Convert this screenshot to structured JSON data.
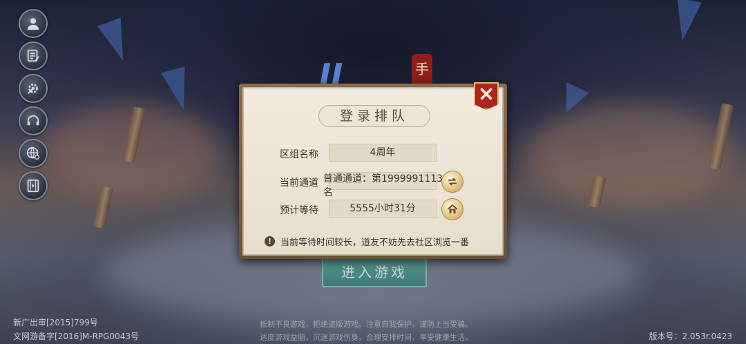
{
  "background": {
    "logo_text": "JJ",
    "logo_seal": "手",
    "enter_button": "进入游戏"
  },
  "side_menu": [
    {
      "icon": "user-icon"
    },
    {
      "icon": "notice-scroll-icon"
    },
    {
      "icon": "settings-icon"
    },
    {
      "icon": "headset-icon"
    },
    {
      "icon": "globe-search-icon"
    },
    {
      "icon": "video-icon"
    }
  ],
  "dialog": {
    "title": "登录排队",
    "close_icon": "close-icon",
    "zone_label": "区组名称",
    "zone_value": "4周年",
    "channel_label": "当前通道",
    "channel_value": "普通通道：第1999991113名",
    "wait_label": "预计等待",
    "wait_value": "5555小时31分",
    "notice_icon": "!",
    "notice": "当前等待时间较长，道友不妨先去社区浏览一番"
  },
  "footer": {
    "license_1": "新广出审[2015]799号",
    "license_2": "文网游备字[2016]M-RPG0043号",
    "health_1": "抵制不良游戏，拒绝盗版游戏。注意自我保护，谨防上当受骗。",
    "health_2": "适度游戏益脑，沉迷游戏伤身。合理安排时间，享受健康生活。",
    "version": "版本号：2.053r.0423"
  },
  "colors": {
    "dialog_frame": "#8a6b4b",
    "dialog_bg": "#f1ebdf",
    "close_red": "#b0241c",
    "enter_teal": "#3f9486"
  }
}
